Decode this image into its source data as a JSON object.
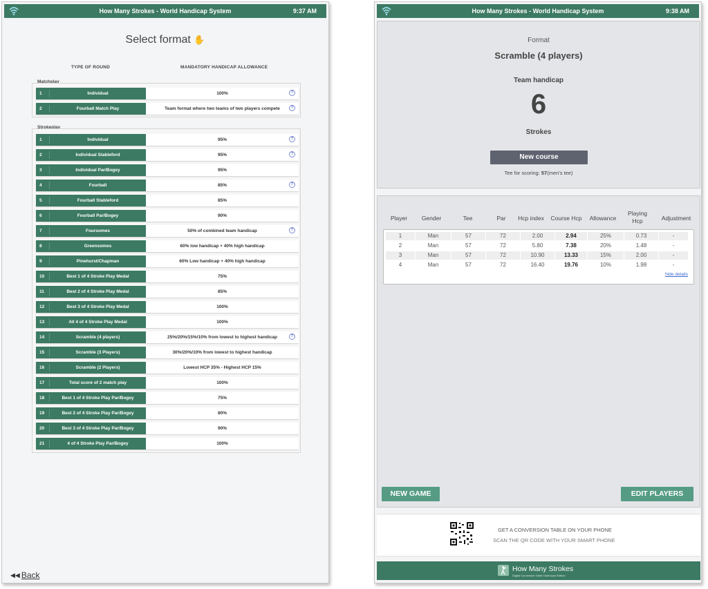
{
  "topbar_left": {
    "title": "How Many Strokes - World Handicap System",
    "time": "9:37 AM"
  },
  "topbar_right": {
    "title": "How Many Strokes - World Handicap System",
    "time": "9:38 AM"
  },
  "left": {
    "title": "Select format",
    "col_type": "TYPE OF ROUND",
    "col_allowance": "MANDATORY HANDICAP ALLOWANCE",
    "matchplay_label": "Matchplay",
    "matchplay": [
      {
        "num": "1",
        "name": "Individual",
        "allowance": "100%",
        "help": true
      },
      {
        "num": "2",
        "name": "Fourball Match Play",
        "allowance": "Team format where two teams of two players compete",
        "help": true
      }
    ],
    "strokeplay_label": "Strokeplay",
    "strokeplay": [
      {
        "num": "1",
        "name": "Individual",
        "allowance": "95%",
        "help": true
      },
      {
        "num": "2",
        "name": "Individual Stableford",
        "allowance": "95%",
        "help": true
      },
      {
        "num": "3",
        "name": "Individual Par/Bogey",
        "allowance": "95%",
        "help": false
      },
      {
        "num": "4",
        "name": "Fourball",
        "allowance": "85%",
        "help": true
      },
      {
        "num": "5",
        "name": "Fourball Stableford",
        "allowance": "85%",
        "help": false
      },
      {
        "num": "6",
        "name": "Fourball Par/Bogey",
        "allowance": "90%",
        "help": false
      },
      {
        "num": "7",
        "name": "Foursomes",
        "allowance": "50% of combined team handicap",
        "help": true
      },
      {
        "num": "8",
        "name": "Greensomes",
        "allowance": "60% low handicap + 40% high handicap",
        "help": false
      },
      {
        "num": "9",
        "name": "Pinehurst/Chapman",
        "allowance": "60% Low handicap + 40% high handicap",
        "help": false
      },
      {
        "num": "10",
        "name": "Best 1 of 4 Stroke Play Medal",
        "allowance": "75%",
        "help": false
      },
      {
        "num": "11",
        "name": "Best 2 of 4 Stroke Play Medal",
        "allowance": "85%",
        "help": false
      },
      {
        "num": "12",
        "name": "Best 3 of 4 Stroke Play Medal",
        "allowance": "100%",
        "help": false
      },
      {
        "num": "13",
        "name": "All 4 of 4 Stroke Play Medal",
        "allowance": "100%",
        "help": false
      },
      {
        "num": "14",
        "name": "Scramble (4 players)",
        "allowance": "25%/20%/15%/10% from lowest to highest handicap",
        "help": true
      },
      {
        "num": "15",
        "name": "Scramble (3 Players)",
        "allowance": "30%/20%/10% from lowest to highest handicap",
        "help": false
      },
      {
        "num": "16",
        "name": "Scramble (2 Players)",
        "allowance": "Lowest HCP 35% - Highest HCP 15%",
        "help": false
      },
      {
        "num": "17",
        "name": "Total score of 2 match play",
        "allowance": "100%",
        "help": false
      },
      {
        "num": "18",
        "name": "Best 1 of 4 Stroke Play Par/Bogey",
        "allowance": "75%",
        "help": false
      },
      {
        "num": "19",
        "name": "Best 2 of 4 Stroke Play Par/Bogey",
        "allowance": "80%",
        "help": false
      },
      {
        "num": "20",
        "name": "Best 3 of 4 Stroke Play Par/Bogey",
        "allowance": "90%",
        "help": false
      },
      {
        "num": "21",
        "name": "4 of 4 Stroke Play Par/Bogey",
        "allowance": "100%",
        "help": false
      }
    ],
    "back_label": "Back"
  },
  "right": {
    "format_label": "Format",
    "format_value": "Scramble (4 players)",
    "team_hcp_label": "Team handicap",
    "team_hcp_value": "6",
    "strokes_label": "Strokes",
    "new_course_label": "New course",
    "tee_prefix": "Tee for scoring: ",
    "tee_value": "57",
    "tee_suffix": "(men's tee)",
    "table_headers": [
      "Player",
      "Gender",
      "Tee",
      "Par",
      "Hcp index",
      "Course Hcp",
      "Allowance",
      "Playing Hcp",
      "Adjustment"
    ],
    "rows": [
      [
        "1",
        "Man",
        "57",
        "72",
        "2.00",
        "2.94",
        "25%",
        "0.73",
        "-"
      ],
      [
        "2",
        "Man",
        "57",
        "72",
        "5.80",
        "7.38",
        "20%",
        "1.48",
        "-"
      ],
      [
        "3",
        "Man",
        "57",
        "72",
        "10.90",
        "13.33",
        "15%",
        "2.00",
        "-"
      ],
      [
        "4",
        "Man",
        "57",
        "72",
        "16.40",
        "19.76",
        "10%",
        "1.98",
        "-"
      ]
    ],
    "hide_details": "hide details",
    "new_game_label": "NEW GAME",
    "edit_players_label": "EDIT PLAYERS",
    "qr_line1": "GET A CONVERSION TABLE ON YOUR PHONE",
    "qr_line2": "SCAN THE QR CODE WITH YOUR SMART PHONE",
    "footer_title": "How Many Strokes",
    "footer_sub": "Digital Conversion Table Clubhouse Edition"
  },
  "colors": {
    "brand_green": "#3c7a63",
    "button_green": "#569c84",
    "button_gray": "#5f6370",
    "link_blue": "#3a6bd0"
  },
  "icons": {
    "wifi": "wifi-icon",
    "wave": "waving-hand-icon",
    "help": "help-circle-icon",
    "back": "double-left-arrow-icon",
    "qr": "qr-code-icon",
    "logo": "golfer-logo-icon"
  }
}
